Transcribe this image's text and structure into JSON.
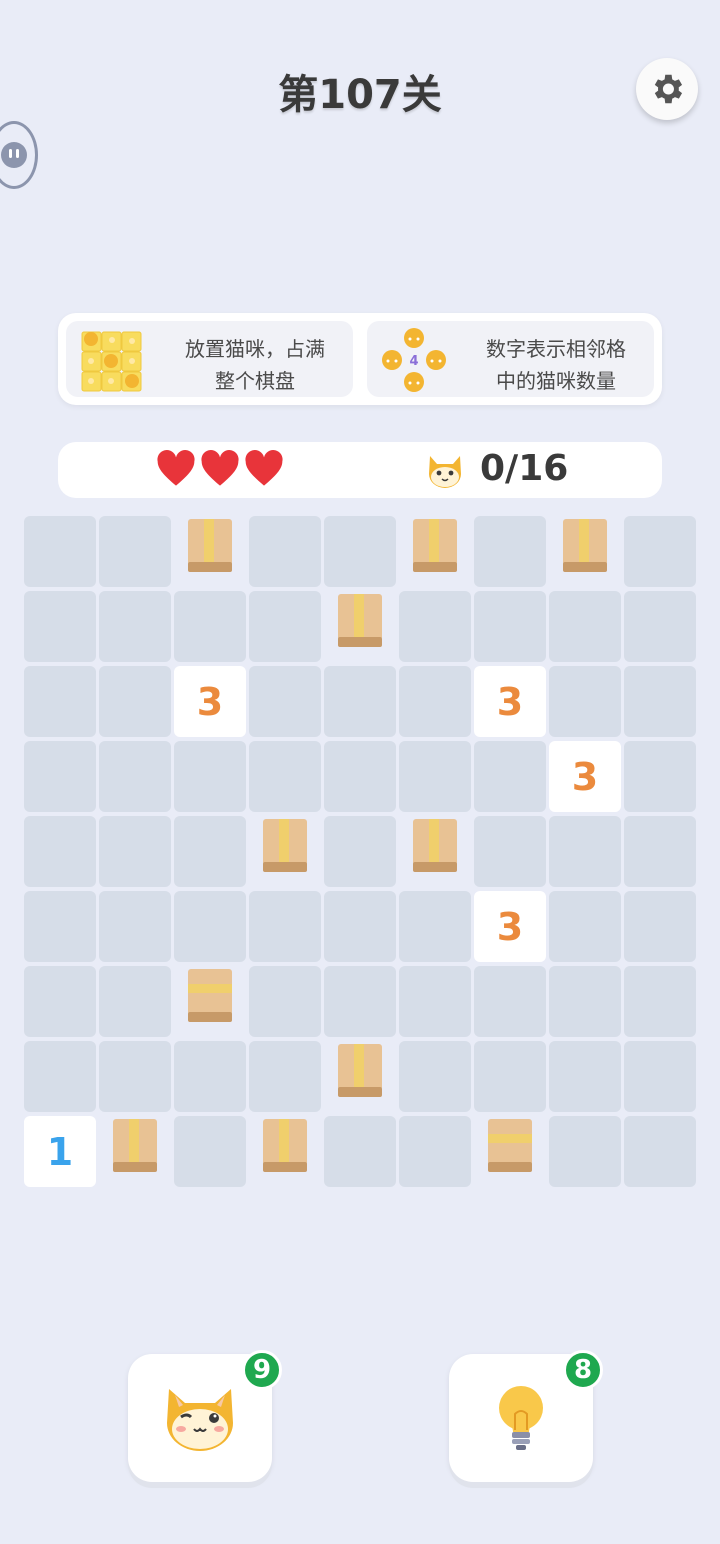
{
  "header": {
    "title": "第107关",
    "settings_icon": "gear-icon"
  },
  "rules": [
    {
      "text_line1": "放置猫咪，占满",
      "text_line2": "整个棋盘",
      "icon": "cat-grid-icon"
    },
    {
      "text_line1": "数字表示相邻格",
      "text_line2": "中的猫咪数量",
      "icon": "cat-cross-icon",
      "icon_number": "4"
    }
  ],
  "status": {
    "lives": 3,
    "cats_placed": "0/16"
  },
  "board": {
    "rows": 9,
    "cols": 9,
    "cells": [
      "e,e,B,e,e,B,e,B,e",
      "e,e,e,e,B,e,e,e,e",
      "e,e,3,e,e,e,3,e,e",
      "e,e,e,e,e,e,e,3,e",
      "e,e,e,B,e,B,e,e,e",
      "e,e,e,e,e,e,3,e,e",
      "e,e,H,e,e,e,e,e,e",
      "e,e,e,e,B,e,e,e,e",
      "1,B,e,B,e,e,H,e,e"
    ],
    "clue_colors": {
      "3": "#eb8a3d",
      "1": "#3aa3ec"
    }
  },
  "tools": [
    {
      "name": "cat",
      "count": "9",
      "icon": "winking-cat-icon"
    },
    {
      "name": "hint",
      "count": "8",
      "icon": "lightbulb-icon"
    }
  ],
  "colors": {
    "background": "#e9ecf7",
    "empty_cell": "#d6dde8",
    "badge": "#1fa84f",
    "heart": "#e8343a"
  }
}
